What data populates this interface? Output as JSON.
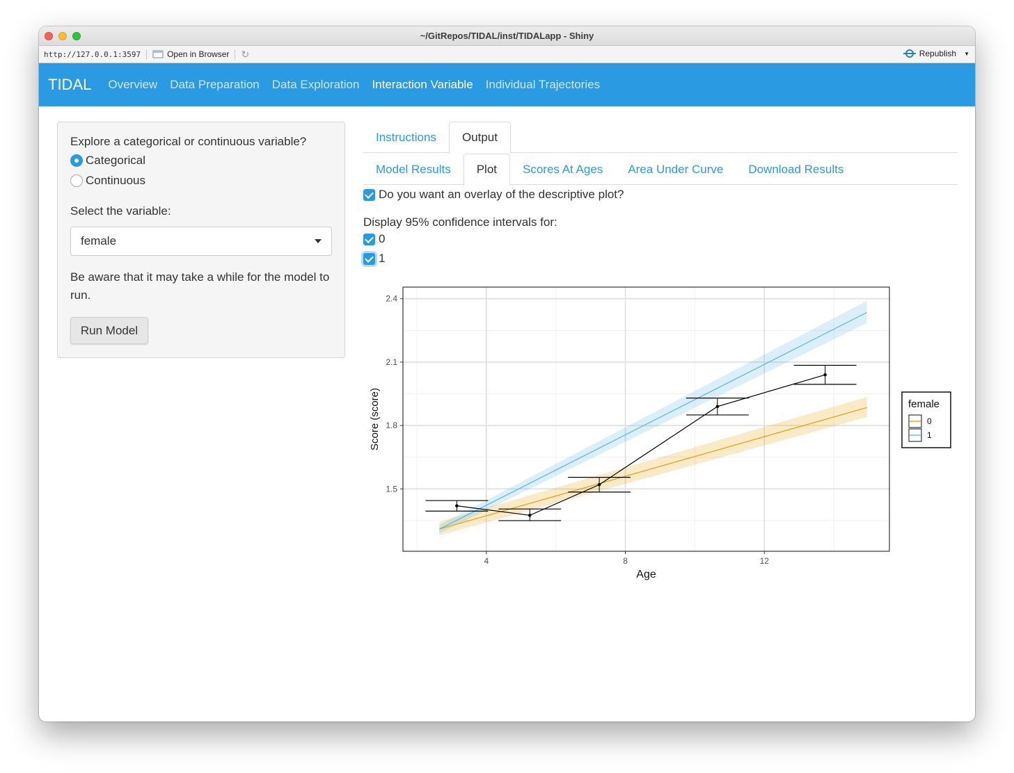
{
  "window": {
    "title": "~/GitRepos/TIDAL/inst/TIDALapp - Shiny",
    "url": "http://127.0.0.1:3597",
    "open_in_browser": "Open in Browser",
    "republish": "Republish"
  },
  "navbar": {
    "brand": "TIDAL",
    "links": [
      "Overview",
      "Data Preparation",
      "Data Exploration",
      "Interaction Variable",
      "Individual Trajectories"
    ],
    "active": "Interaction Variable"
  },
  "sidebar": {
    "question": "Explore a categorical or continuous variable?",
    "options": [
      "Categorical",
      "Continuous"
    ],
    "selected_option": "Categorical",
    "select_label": "Select the variable:",
    "select_value": "female",
    "note": "Be aware that it may take a while for the model to run.",
    "run_button": "Run Model"
  },
  "tabs": {
    "outer": [
      "Instructions",
      "Output"
    ],
    "outer_active": "Output",
    "inner": [
      "Model Results",
      "Plot",
      "Scores At Ages",
      "Area Under Curve",
      "Download Results"
    ],
    "inner_active": "Plot"
  },
  "controls": {
    "overlay_label": "Do you want an overlay of the descriptive plot?",
    "overlay_checked": true,
    "ci_label": "Display 95% confidence intervals for:",
    "ci_options": [
      {
        "label": "0",
        "checked": true
      },
      {
        "label": "1",
        "checked": true
      }
    ]
  },
  "colors": {
    "accent": "#2a9ae3",
    "series_0": "#e69f00",
    "series_1": "#56b4e9",
    "descriptive": "#000000"
  },
  "chart_data": {
    "type": "line",
    "xlabel": "Age",
    "ylabel": "Score (score)",
    "xlim": [
      1.6,
      15.6
    ],
    "ylim": [
      1.205,
      2.455
    ],
    "xticks": [
      4,
      8,
      12
    ],
    "yticks": [
      1.5,
      1.8,
      2.1,
      2.4
    ],
    "grid": true,
    "legend": {
      "title": "female",
      "position": "right",
      "entries": [
        "0",
        "1"
      ]
    },
    "series": [
      {
        "name": "0",
        "x": [
          2.65,
          14.95
        ],
        "y": [
          1.31,
          1.885
        ],
        "ci_lower": [
          1.28,
          1.84
        ],
        "ci_upper": [
          1.345,
          1.935
        ]
      },
      {
        "name": "1",
        "x": [
          2.65,
          14.95
        ],
        "y": [
          1.31,
          2.335
        ],
        "ci_lower": [
          1.29,
          2.285
        ],
        "ci_upper": [
          1.33,
          2.39
        ]
      }
    ],
    "descriptive": {
      "x": [
        3.15,
        5.25,
        7.25,
        10.65,
        13.75
      ],
      "y": [
        1.42,
        1.375,
        1.52,
        1.89,
        2.04
      ],
      "err_low": [
        1.395,
        1.35,
        1.485,
        1.85,
        1.995
      ],
      "err_high": [
        1.445,
        1.405,
        1.555,
        1.93,
        2.085
      ],
      "cap_half_width": [
        0.9,
        0.9,
        0.9,
        0.9,
        0.9
      ]
    }
  }
}
